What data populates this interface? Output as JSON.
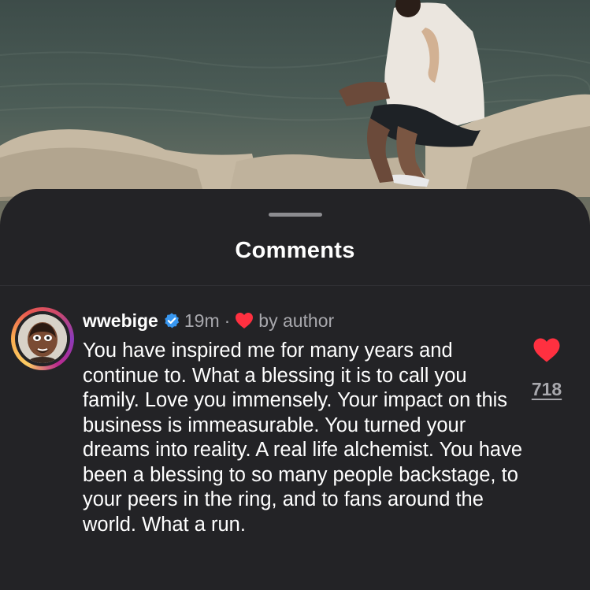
{
  "sheet": {
    "title": "Comments"
  },
  "comment": {
    "username": "wwebige",
    "verified": true,
    "time": "19m",
    "separator": "·",
    "liked_by_author_label": "by author",
    "text": "You have inspired me for many years and continue to. What a blessing it is to call you family. Love you immensely. Your impact on this business is immeasurable. You turned your dreams into reality. A real life alchemist. You have been a blessing to so many people backstage, to your peers in the ring, and to fans around the world. What a run.",
    "like_count": "718",
    "liked": true
  },
  "colors": {
    "sheet_background": "#232326",
    "like_red": "#ff3040",
    "verified_blue": "#3897f0",
    "secondary_text": "#a8a8ad"
  },
  "icons": {
    "verified": "verified-badge-icon",
    "author_like": "heart-icon",
    "like": "heart-icon"
  }
}
